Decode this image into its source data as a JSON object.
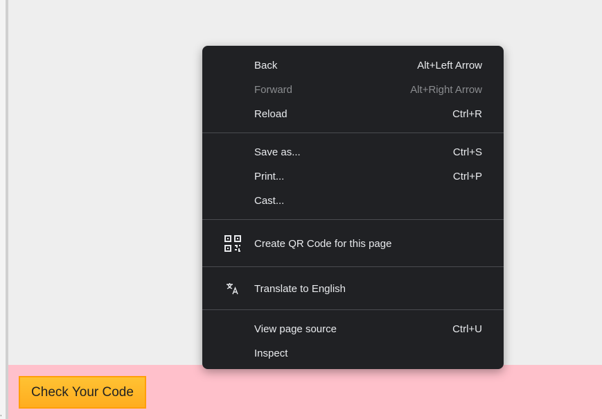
{
  "context_menu": {
    "items": [
      {
        "label": "Back",
        "shortcut": "Alt+Left Arrow"
      },
      {
        "label": "Forward",
        "shortcut": "Alt+Right Arrow"
      },
      {
        "label": "Reload",
        "shortcut": "Ctrl+R"
      },
      {
        "label": "Save as...",
        "shortcut": "Ctrl+S"
      },
      {
        "label": "Print...",
        "shortcut": "Ctrl+P"
      },
      {
        "label": "Cast...",
        "shortcut": ""
      },
      {
        "label": "Create QR Code for this page",
        "shortcut": "",
        "icon": "qr-code-icon"
      },
      {
        "label": "Translate to English",
        "shortcut": "",
        "icon": "translate-icon"
      },
      {
        "label": "View page source",
        "shortcut": "Ctrl+U"
      },
      {
        "label": "Inspect",
        "shortcut": ""
      }
    ]
  },
  "footer": {
    "check_button_label": "Check Your Code"
  },
  "colors": {
    "menu_background": "#202124",
    "footer_background": "#ffc0cb",
    "button_background": "#ffb627"
  }
}
